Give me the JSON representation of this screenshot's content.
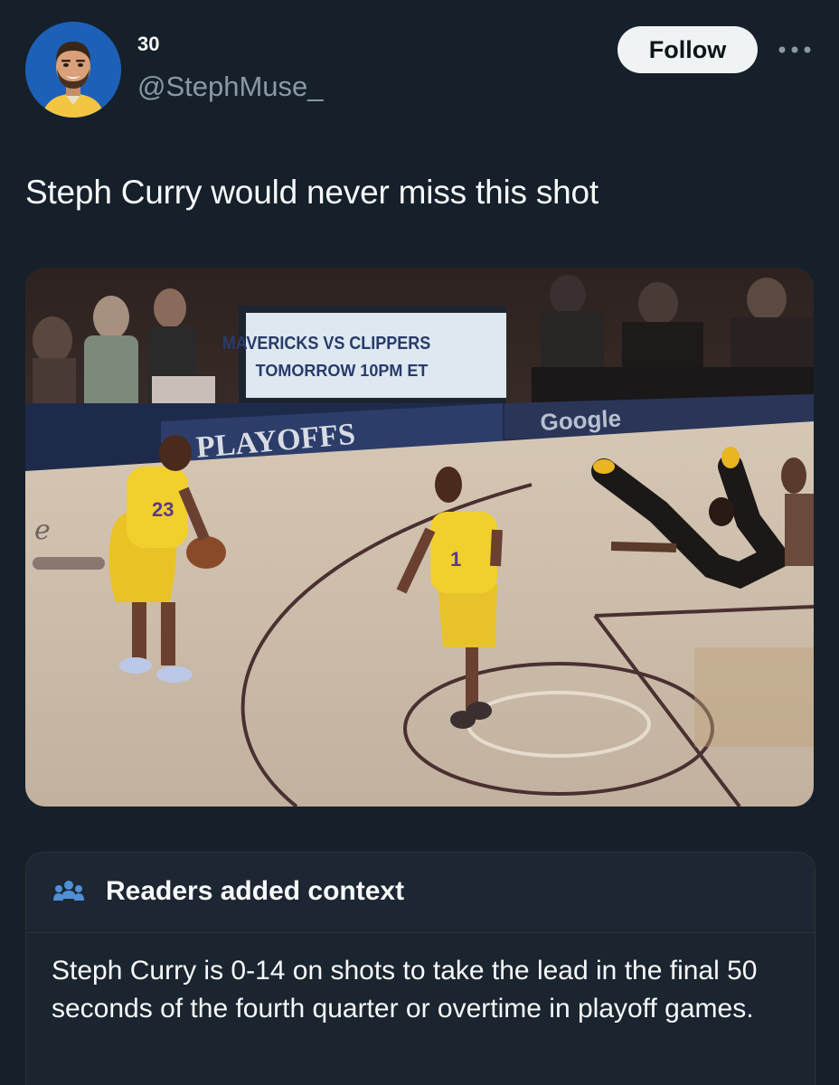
{
  "author": {
    "display_name": "30",
    "handle": "@StephMuse_",
    "avatar_icon": "cartoon-avatar-icon"
  },
  "header": {
    "follow_label": "Follow",
    "more_icon": "more-options-icon"
  },
  "tweet": {
    "text": "Steph Curry would never miss this shot"
  },
  "media": {
    "description_icon": "basketball-video-frame",
    "banner_line1": "MAVERICKS VS CLIPPERS",
    "banner_line2": "TOMORROW 10PM ET",
    "scorers_table_text": "PLAYOFFS",
    "sponsor_text": "Google",
    "jersey_number_left": "23",
    "jersey_number_center": "1"
  },
  "community_note": {
    "icon": "people-group-icon",
    "title": "Readers added context",
    "body": "Steph Curry is 0-14 on shots to take the lead in the final 50 seconds of the fourth quarter or overtime in playoff games."
  },
  "colors": {
    "background": "#15202b",
    "follow_bg": "#eff3f4",
    "secondary_text": "#8b98a5",
    "note_icon": "#4f8fd8"
  }
}
